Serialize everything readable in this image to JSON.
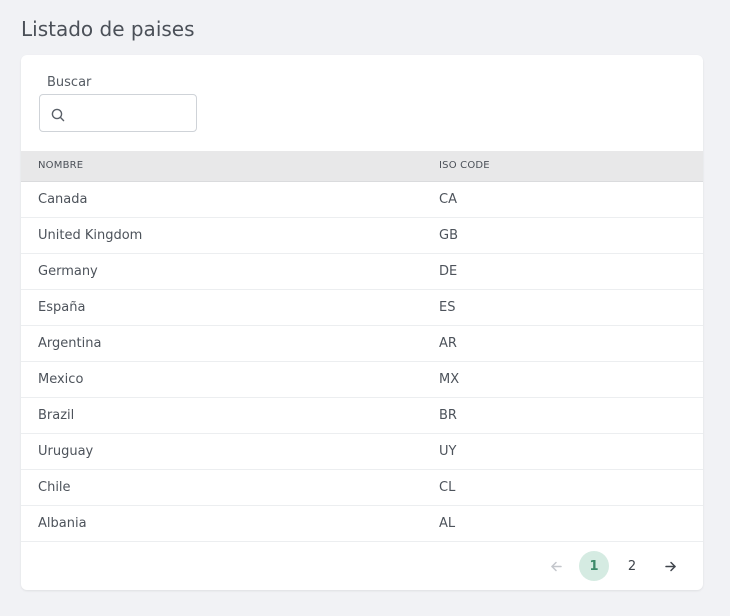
{
  "page": {
    "title": "Listado de paises"
  },
  "search": {
    "label": "Buscar",
    "value": "",
    "placeholder": ""
  },
  "table": {
    "columns": [
      "NOMBRE",
      "ISO CODE"
    ],
    "rows": [
      {
        "name": "Canada",
        "iso": "CA"
      },
      {
        "name": "United Kingdom",
        "iso": "GB"
      },
      {
        "name": "Germany",
        "iso": "DE"
      },
      {
        "name": "España",
        "iso": "ES"
      },
      {
        "name": "Argentina",
        "iso": "AR"
      },
      {
        "name": "Mexico",
        "iso": "MX"
      },
      {
        "name": "Brazil",
        "iso": "BR"
      },
      {
        "name": "Uruguay",
        "iso": "UY"
      },
      {
        "name": "Chile",
        "iso": "CL"
      },
      {
        "name": "Albania",
        "iso": "AL"
      }
    ]
  },
  "pagination": {
    "pages": [
      "1",
      "2"
    ],
    "current": "1",
    "prev_icon": "arrow-left-icon",
    "next_icon": "arrow-right-icon",
    "active_color": "#d5ebe2"
  }
}
